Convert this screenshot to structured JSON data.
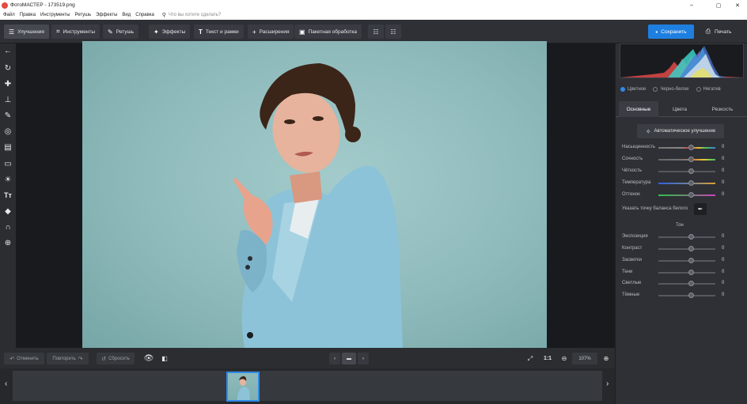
{
  "window": {
    "title": "ФотоМАСТЕР - 173519.png",
    "minimize": "–",
    "maximize": "▢",
    "close": "✕"
  },
  "menu": {
    "items": [
      "Файл",
      "Правка",
      "Инструменты",
      "Ретушь",
      "Эффекты",
      "Вид",
      "Справка"
    ],
    "search_placeholder": "Что вы хотите сделать?"
  },
  "toolbar": {
    "tabs": [
      {
        "label": "Улучшения",
        "icon": "sliders-icon"
      },
      {
        "label": "Инструменты",
        "icon": "crop-icon"
      },
      {
        "label": "Ретушь",
        "icon": "brush-icon"
      },
      {
        "label": "Эффекты",
        "icon": "sparkle-icon"
      },
      {
        "label": "Текст и рамки",
        "icon": "text-icon"
      },
      {
        "label": "Расширения",
        "icon": "plus-icon"
      },
      {
        "label": "Пакетная обработка",
        "icon": "batch-image-icon"
      }
    ],
    "active_tab": "Улучшения",
    "save_label": "Сохранить",
    "print_label": "Печать",
    "accent_color": "#1f7fe0"
  },
  "left_tools": [
    "back-arrow-icon",
    "rotate-icon",
    "healing-icon",
    "stamp-icon",
    "brush-icon",
    "radial-filter-icon",
    "gradient-filter-icon",
    "vignette-icon",
    "light-icon",
    "text-tool-icon",
    "fill-icon",
    "horseshoe-icon",
    "geolocation-icon"
  ],
  "bottom": {
    "undo_label": "Отменить",
    "redo_label": "Повторить",
    "reset_label": "Сбросить",
    "ratio_label": "1:1",
    "zoom": "107%"
  },
  "right_panel": {
    "modes": [
      "Цветное",
      "Черно-белое",
      "Негатив"
    ],
    "selected_mode": "Цветное",
    "tabs": [
      "Основные",
      "Цвета",
      "Резкость"
    ],
    "active_tab": "Основные",
    "auto_label": "Автоматическое улучшение",
    "color_sliders": [
      {
        "label": "Насыщенность",
        "value": "0"
      },
      {
        "label": "Сочность",
        "value": "0"
      },
      {
        "label": "Чёткость",
        "value": "0"
      },
      {
        "label": "Температура",
        "value": "0"
      },
      {
        "label": "Оттенок",
        "value": "0"
      }
    ],
    "white_balance_label": "Указать точку баланса белого",
    "tone_header": "Тон",
    "tone_sliders": [
      {
        "label": "Экспозиция",
        "value": "0"
      },
      {
        "label": "Контраст",
        "value": "0"
      },
      {
        "label": "Засветки",
        "value": "0"
      },
      {
        "label": "Тени",
        "value": "0"
      },
      {
        "label": "Светлые",
        "value": "0"
      },
      {
        "label": "Тёмные",
        "value": "0"
      }
    ]
  }
}
